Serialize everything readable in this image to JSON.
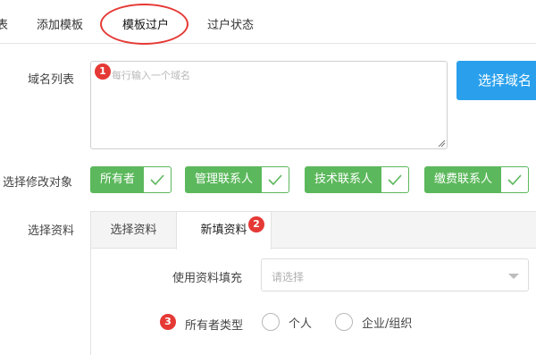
{
  "top_tabs": {
    "partial_left": "表",
    "add_template": "添加模板",
    "template_transfer": "模板过户",
    "transfer_status": "过户状态"
  },
  "domain_list": {
    "label": "域名列表",
    "placeholder": "每行输入一个域名",
    "select_button": "选择域名"
  },
  "modify_target": {
    "label": "选择修改对象",
    "options": [
      "所有者",
      "管理联系人",
      "技术联系人",
      "缴费联系人"
    ]
  },
  "info": {
    "label": "选择资料",
    "tabs": [
      "选择资料",
      "新填资料"
    ],
    "fill_label": "使用资料填充",
    "fill_placeholder": "请选择",
    "owner_type_label": "所有者类型",
    "owner_type_options": [
      "个人",
      "企业/组织"
    ]
  },
  "badges": [
    "1",
    "2",
    "3"
  ],
  "colors": {
    "accent_blue": "#2aa0ec",
    "check_green": "#5cb85c",
    "annotation_red": "#e53935"
  }
}
